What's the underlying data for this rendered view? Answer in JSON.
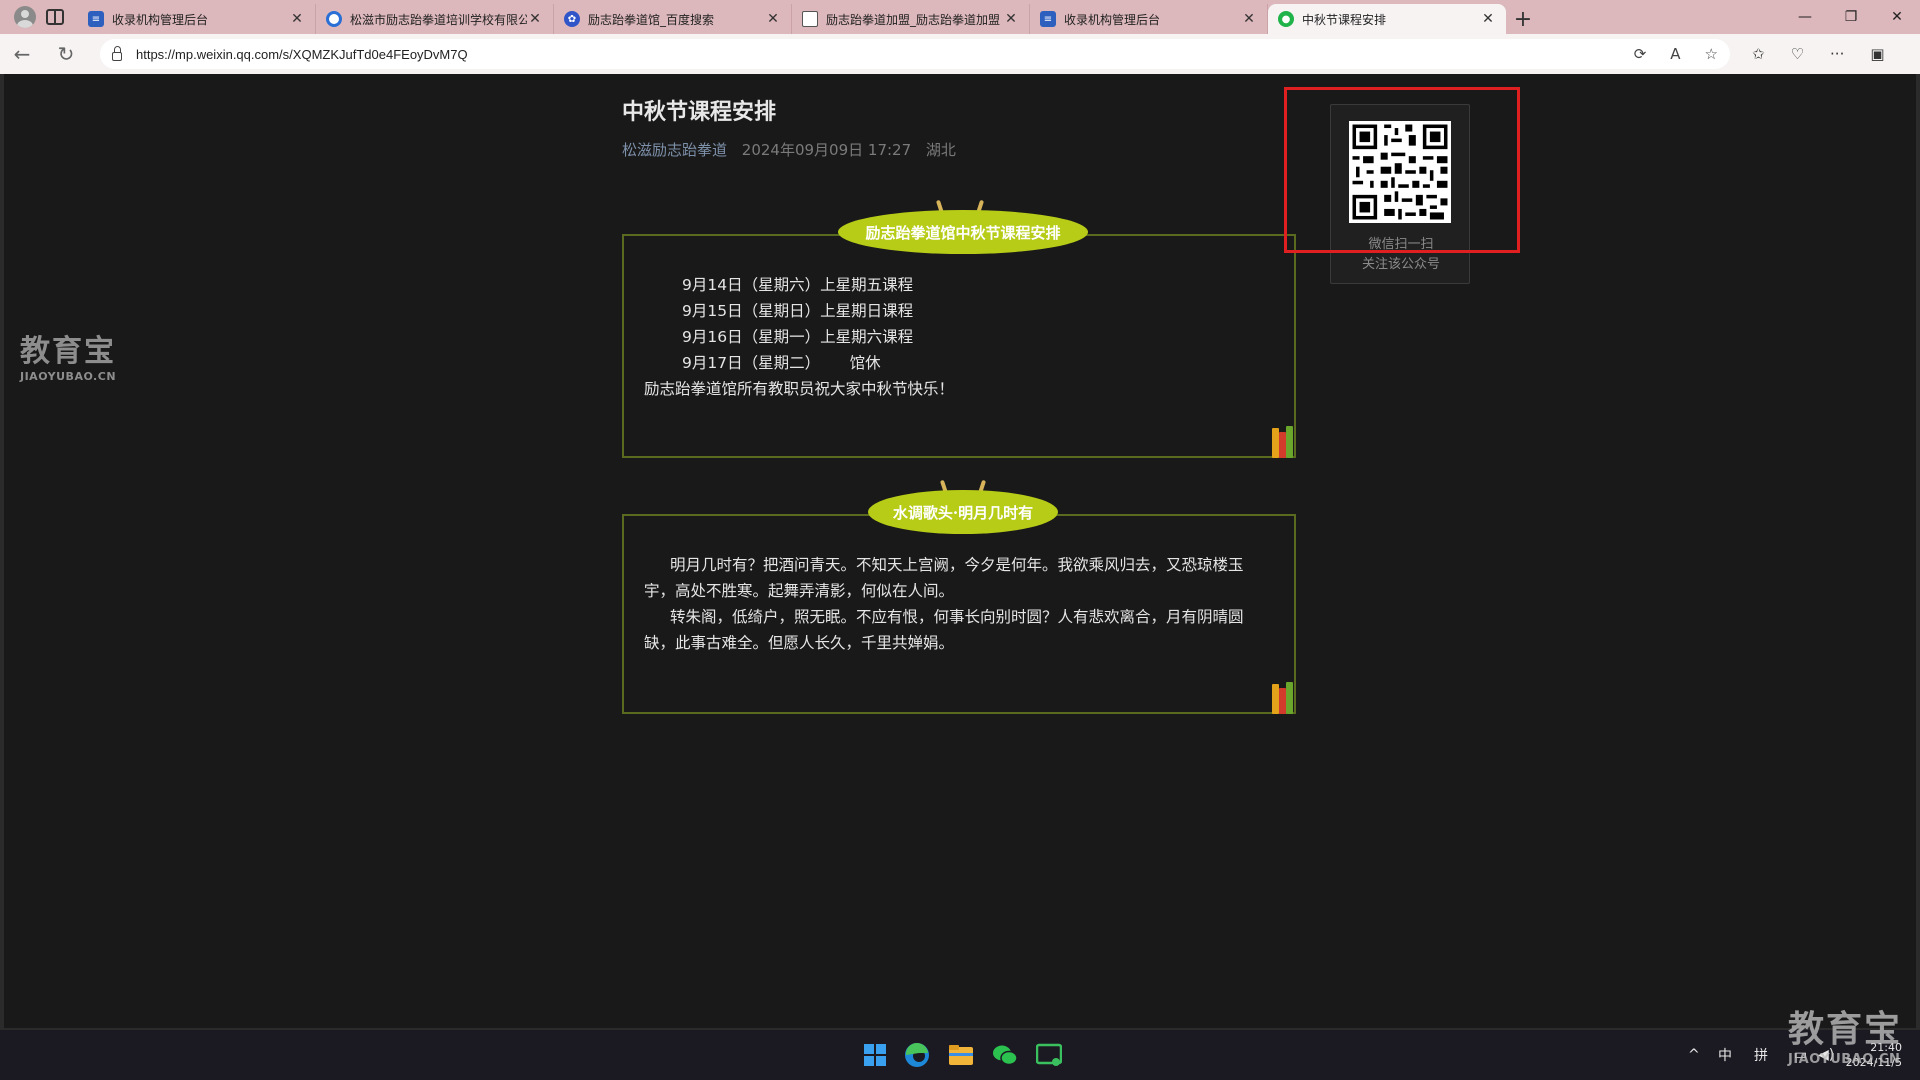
{
  "browser": {
    "tabs": [
      {
        "title": "收录机构管理后台",
        "favicon": "admin-icon"
      },
      {
        "title": "松滋市励志跆拳道培训学校有限公",
        "favicon": "search-engine-icon"
      },
      {
        "title": "励志跆拳道馆_百度搜索",
        "favicon": "baidu-paw-icon"
      },
      {
        "title": "励志跆拳道加盟_励志跆拳道加盟",
        "favicon": "document-icon"
      },
      {
        "title": "收录机构管理后台",
        "favicon": "admin-icon"
      },
      {
        "title": "中秋节课程安排",
        "favicon": "wechat-icon",
        "active": true
      }
    ],
    "url": "https://mp.weixin.qq.com/s/XQMZKJufTd0e4FEoyDvM7Q"
  },
  "watermark": {
    "name": "教育宝",
    "domain": "JIAOYUBAO.CN"
  },
  "article": {
    "title": "中秋节课程安排",
    "author": "松滋励志跆拳道",
    "date": "2024年09月09日 17:27",
    "location": "湖北",
    "section1": {
      "heading": "励志跆拳道馆中秋节课程安排",
      "lines": [
        "9月14日（星期六）上星期五课程",
        "9月15日（星期日）上星期日课程",
        "9月16日（星期一）上星期六课程",
        "9月17日（星期二）      馆休"
      ],
      "closing": "励志跆拳道馆所有教职员祝大家中秋节快乐！"
    },
    "section2": {
      "heading": "水调歌头·明月几时有",
      "paragraphs": [
        "明月几时有？把酒问青天。不知天上宫阙，今夕是何年。我欲乘风归去，又恐琼楼玉宇，高处不胜寒。起舞弄清影，何似在人间。",
        "转朱阁，低绮户，照无眠。不应有恨，何事长向别时圆？人有悲欢离合，月有阴晴圆缺，此事古难全。但愿人长久，千里共婵娟。"
      ]
    }
  },
  "qr": {
    "line1": "微信扫一扫",
    "line2": "关注该公众号"
  },
  "taskbar": {
    "apps": [
      "windows-start-icon",
      "edge-icon",
      "file-explorer-icon",
      "wechat-icon",
      "terminal-icon"
    ],
    "ime1": "中",
    "ime2": "拼",
    "time": "21:40",
    "date": "2024/11/5"
  },
  "colors": {
    "accent_pill": "#b7cc16",
    "frame": "#5a6b1f",
    "highlight": "#e02020",
    "page_bg": "#191919"
  }
}
